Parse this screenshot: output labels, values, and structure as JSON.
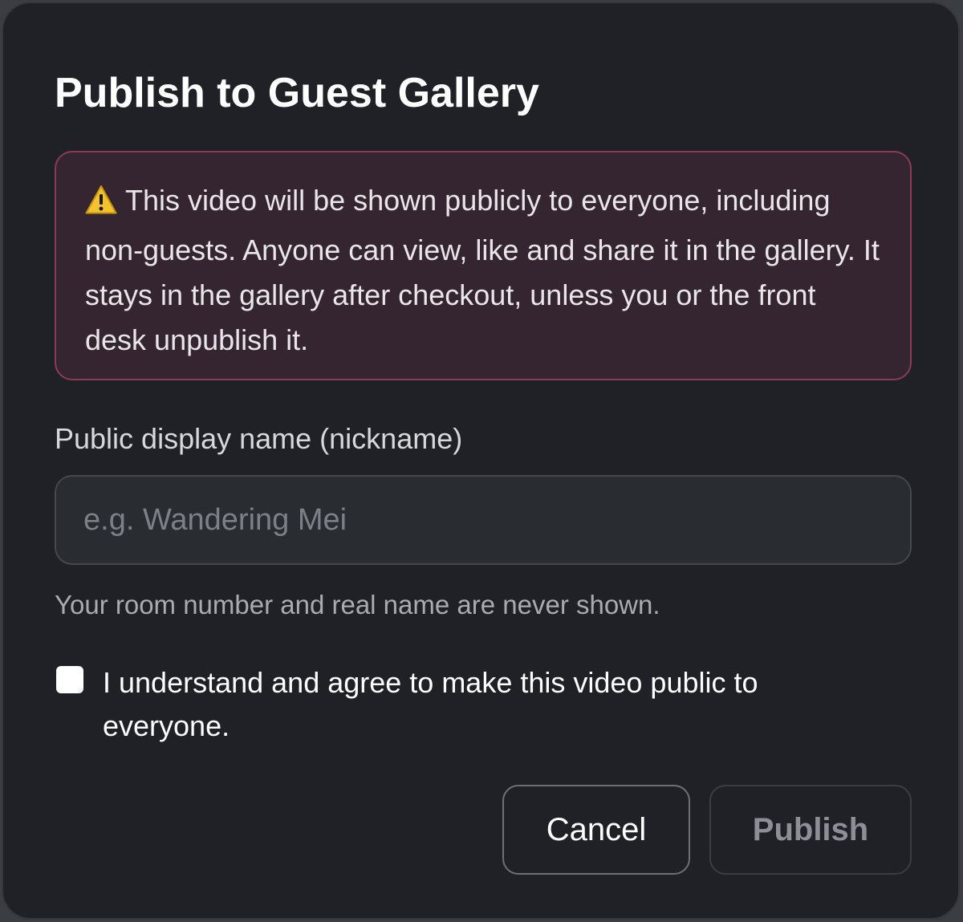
{
  "dialog": {
    "title": "Publish to Guest Gallery",
    "warning": {
      "icon": "warning-icon",
      "text": "This video will be shown publicly to everyone, including non-guests. Anyone can view, like and share it in the gallery. It stays in the gallery after checkout, unless you or the front desk unpublish it."
    },
    "nickname": {
      "label": "Public display name (nickname)",
      "placeholder": "e.g. Wandering Mei",
      "value": "",
      "hint": "Your room number and real name are never shown."
    },
    "consent": {
      "checked": false,
      "label": "I understand and agree to make this video public to everyone."
    },
    "buttons": {
      "cancel_label": "Cancel",
      "publish_label": "Publish",
      "publish_enabled": false
    },
    "colors": {
      "background": "#1f2127",
      "warning_background": "#342530",
      "warning_border": "#8a3c55",
      "warning_icon": "#f2c230"
    }
  }
}
